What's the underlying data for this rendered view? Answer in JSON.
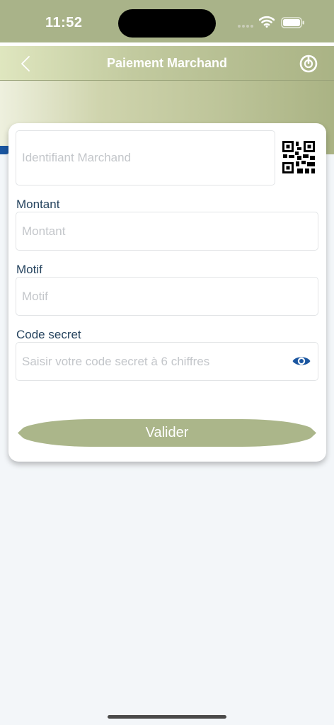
{
  "status_bar": {
    "time": "11:52"
  },
  "header": {
    "title": "Paiement Marchand",
    "back_icon": "chevron-left-icon",
    "power_icon": "power-icon"
  },
  "form": {
    "merchant_id": {
      "placeholder": "Identifiant Marchand",
      "action_icon": "qr-code-icon"
    },
    "amount": {
      "label": "Montant",
      "placeholder": "Montant"
    },
    "reason": {
      "label": "Motif",
      "placeholder": "Motif"
    },
    "secret_code": {
      "label": "Code secret",
      "placeholder": "Saisir votre code secret à 6 chiffres",
      "toggle_icon": "eye-icon"
    },
    "submit_label": "Valider"
  },
  "colors": {
    "brand": "#abb68a",
    "accent_blue": "#1b56a0",
    "label": "#26445f",
    "placeholder": "#c3c6ca"
  }
}
